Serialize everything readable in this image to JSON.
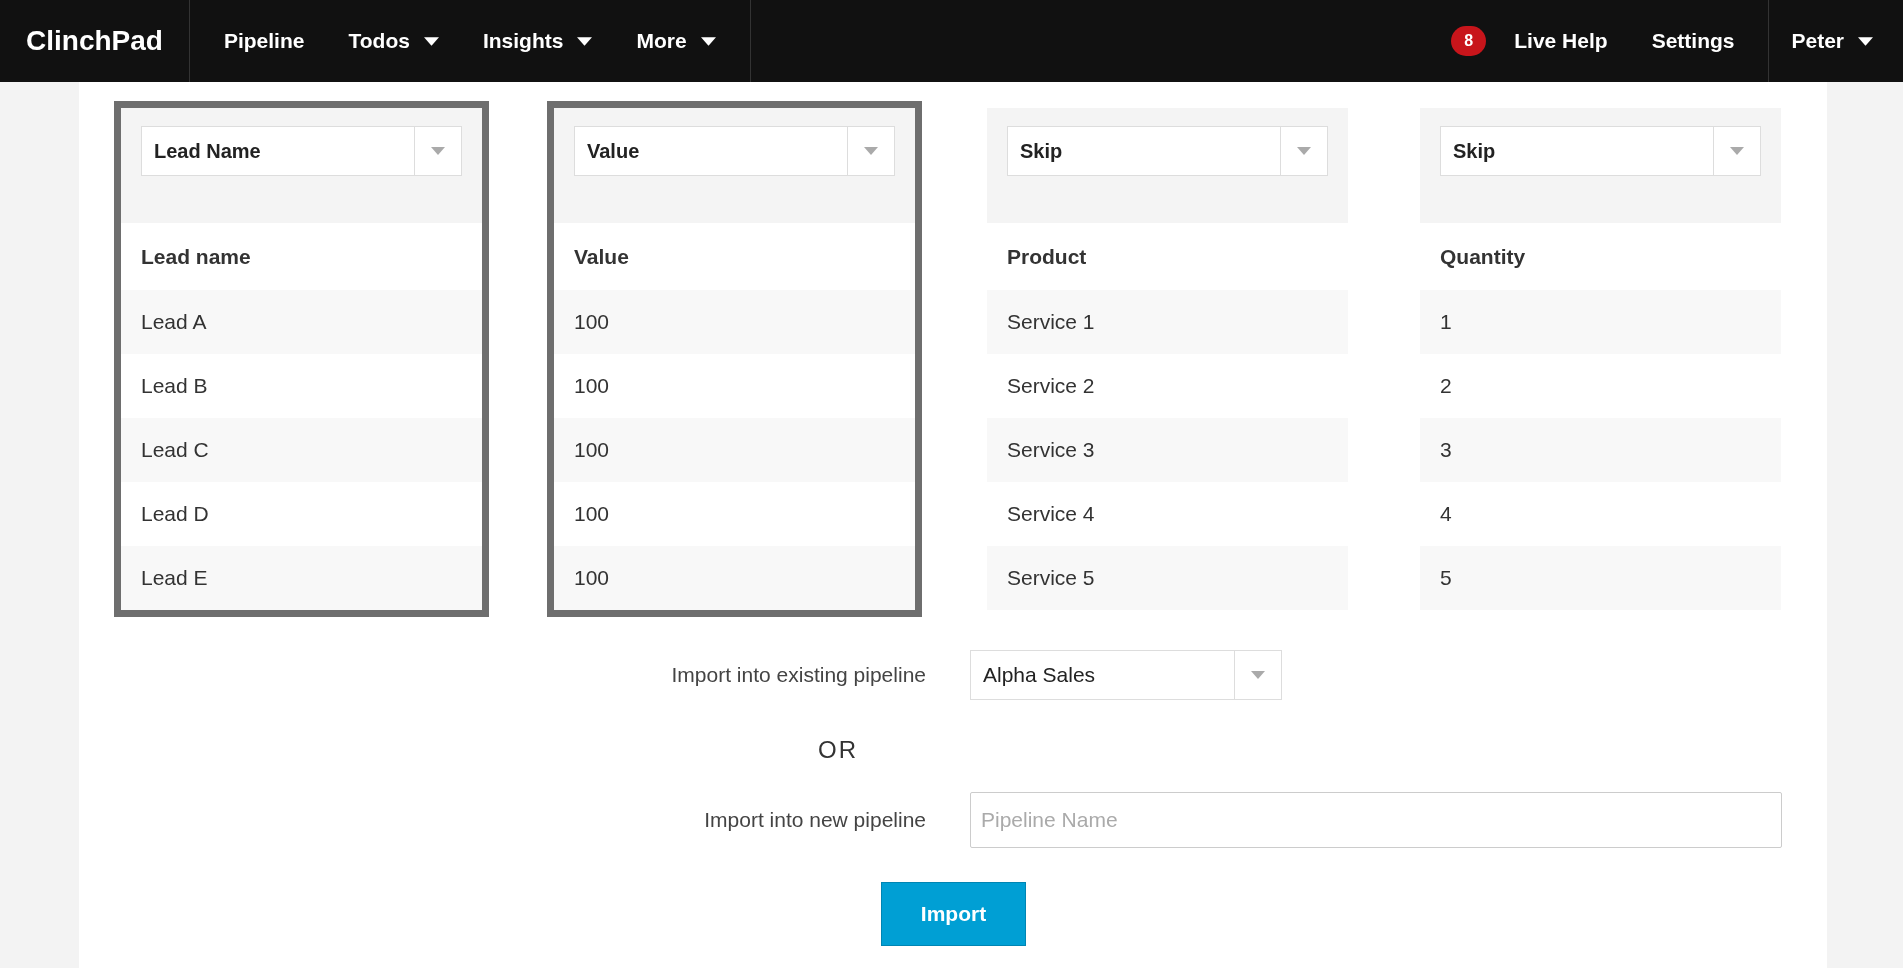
{
  "navbar": {
    "brand": "ClinchPad",
    "items": [
      {
        "label": "Pipeline",
        "kind": "link"
      },
      {
        "label": "Todos",
        "kind": "dropdown"
      },
      {
        "label": "Insights",
        "kind": "dropdown"
      },
      {
        "label": "More",
        "kind": "dropdown"
      }
    ],
    "notifications_badge": "8",
    "right_items": [
      "Live Help",
      "Settings"
    ],
    "user_menu": {
      "label": "Peter",
      "kind": "dropdown"
    }
  },
  "columns": [
    {
      "mapping": "Lead Name",
      "header": "Lead name",
      "selected": true,
      "cells": [
        "Lead A",
        "Lead B",
        "Lead C",
        "Lead D",
        "Lead E"
      ]
    },
    {
      "mapping": "Value",
      "header": "Value",
      "selected": true,
      "cells": [
        "100",
        "100",
        "100",
        "100",
        "100"
      ]
    },
    {
      "mapping": "Skip",
      "header": "Product",
      "selected": false,
      "cells": [
        "Service 1",
        "Service 2",
        "Service 3",
        "Service 4",
        "Service 5"
      ]
    },
    {
      "mapping": "Skip",
      "header": "Quantity",
      "selected": false,
      "cells": [
        "1",
        "2",
        "3",
        "4",
        "5"
      ]
    }
  ],
  "existing_pipeline": {
    "label": "Import into existing pipeline",
    "value": "Alpha Sales"
  },
  "separator": "OR",
  "new_pipeline": {
    "label": "Import into new pipeline",
    "placeholder": "Pipeline Name"
  },
  "import_button": "Import"
}
